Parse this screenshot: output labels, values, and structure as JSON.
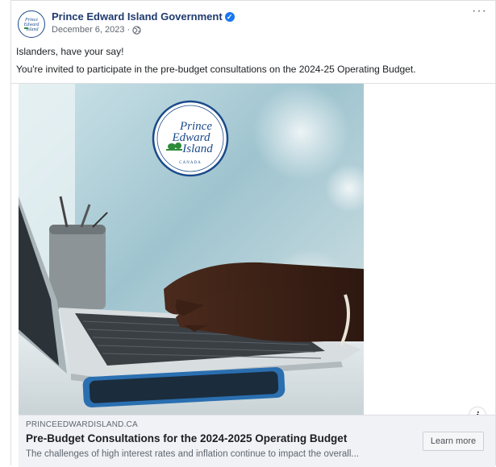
{
  "post": {
    "page_name": "Prince Edward Island Government",
    "date": "December 6, 2023 · ",
    "more_label": "···",
    "text_lines": [
      "Islanders, have your say!",
      "You're invited to participate in the pre-budget consultations on the 2024-25 Operating Budget."
    ]
  },
  "logo": {
    "line1": "Prince",
    "line2": "Edward",
    "line3": "Island",
    "country": "CANADA"
  },
  "link": {
    "domain": "PRINCEEDWARDISLAND.CA",
    "title": "Pre-Budget Consultations for the 2024-2025 Operating Budget",
    "description": "The challenges of high interest rates and inflation continue to impact the overall...",
    "cta": "Learn more",
    "info": "i"
  },
  "icons": {
    "verified": "verified-badge-icon",
    "audience": "globe-icon",
    "more": "more-options-icon"
  },
  "colors": {
    "page_name": "#1f3a6e",
    "verified": "#1877f2",
    "link_bar": "#f0f2f5"
  }
}
